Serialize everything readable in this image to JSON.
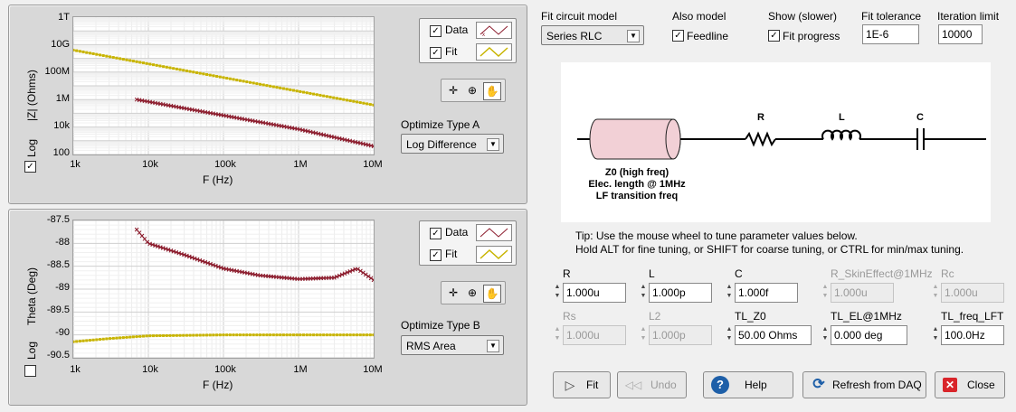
{
  "top_plot": {
    "y_ticks": [
      "1T",
      "10G",
      "100M",
      "1M",
      "10k",
      "100"
    ],
    "x_ticks": [
      "1k",
      "10k",
      "100k",
      "1M",
      "10M"
    ],
    "y_label": "|Z| (Ohms)",
    "x_label": "F (Hz)",
    "log_label": "Log",
    "log_checked": true,
    "legend": [
      {
        "name": "Data",
        "checked": true
      },
      {
        "name": "Fit",
        "checked": true
      }
    ],
    "optimize_label": "Optimize Type A",
    "optimize_value": "Log Difference"
  },
  "bottom_plot": {
    "y_ticks": [
      "-87.5",
      "-88",
      "-88.5",
      "-89",
      "-89.5",
      "-90",
      "-90.5"
    ],
    "x_ticks": [
      "1k",
      "10k",
      "100k",
      "1M",
      "10M"
    ],
    "y_label": "Theta (Deg)",
    "x_label": "F (Hz)",
    "log_label": "Log",
    "log_checked": false,
    "legend": [
      {
        "name": "Data",
        "checked": true
      },
      {
        "name": "Fit",
        "checked": true
      }
    ],
    "optimize_label": "Optimize Type B",
    "optimize_value": "RMS Area"
  },
  "chart_data": [
    {
      "type": "line",
      "xlabel": "F (Hz)",
      "ylabel": "|Z| (Ohms)",
      "xscale": "log",
      "yscale": "log",
      "xlim": [
        1000,
        10000000
      ],
      "ylim": [
        100,
        1000000000000
      ],
      "grid": true,
      "legend_position": "right",
      "series": [
        {
          "name": "Fit",
          "color": "#c8b400",
          "x": [
            1000,
            10000,
            100000,
            1000000,
            10000000
          ],
          "y": [
            4000000000,
            400000000,
            40000000,
            4000000,
            400000
          ]
        },
        {
          "name": "Data",
          "color": "#8b1a2b",
          "x": [
            7000,
            10000,
            100000,
            1000000,
            10000000
          ],
          "y": [
            1000000,
            700000,
            70000,
            7000,
            400
          ]
        }
      ]
    },
    {
      "type": "line",
      "xlabel": "F (Hz)",
      "ylabel": "Theta (Deg)",
      "xscale": "log",
      "xlim": [
        1000,
        10000000
      ],
      "ylim": [
        -90.5,
        -87.5
      ],
      "grid": true,
      "legend_position": "right",
      "series": [
        {
          "name": "Fit",
          "color": "#c8b400",
          "x": [
            1000,
            3000,
            10000,
            100000,
            1000000,
            10000000
          ],
          "y": [
            -90.15,
            -90.08,
            -90.02,
            -90.0,
            -90.0,
            -90.0
          ]
        },
        {
          "name": "Data",
          "color": "#8b1a2b",
          "x": [
            7000,
            10000,
            30000,
            100000,
            300000,
            1000000,
            3000000,
            6000000,
            10000000
          ],
          "y": [
            -87.7,
            -88.0,
            -88.25,
            -88.55,
            -88.7,
            -88.78,
            -88.75,
            -88.55,
            -88.8
          ]
        }
      ]
    }
  ],
  "controls": {
    "fit_model_label": "Fit circuit model",
    "fit_model_value": "Series RLC",
    "also_model_label": "Also model",
    "feedline_label": "Feedline",
    "feedline_checked": true,
    "show_label": "Show (slower)",
    "fit_progress_label": "Fit progress",
    "fit_progress_checked": true,
    "tolerance_label": "Fit tolerance",
    "tolerance_value": "1E-6",
    "iteration_label": "Iteration limit",
    "iteration_value": "10000"
  },
  "circuit": {
    "r": "R",
    "l": "L",
    "c": "C",
    "tl_caption": [
      "Z0 (high freq)",
      "Elec. length @ 1MHz",
      "LF transition freq"
    ]
  },
  "tip": {
    "line1": "Tip: Use the mouse wheel to tune parameter values below.",
    "line2": "Hold ALT for fine tuning, or SHIFT for coarse tuning, or CTRL for min/max tuning."
  },
  "params": [
    {
      "label": "R",
      "value": "1.000u",
      "enabled": true
    },
    {
      "label": "L",
      "value": "1.000p",
      "enabled": true
    },
    {
      "label": "C",
      "value": "1.000f",
      "enabled": true
    },
    {
      "label": "R_SkinEffect@1MHz",
      "value": "1.000u",
      "enabled": false
    },
    {
      "label": "Rc",
      "value": "1.000u",
      "enabled": false
    },
    {
      "label": "Rs",
      "value": "1.000u",
      "enabled": false
    },
    {
      "label": "L2",
      "value": "1.000p",
      "enabled": false
    },
    {
      "label": "TL_Z0",
      "value": "50.00 Ohms",
      "enabled": true
    },
    {
      "label": "TL_EL@1MHz",
      "value": "0.000 deg",
      "enabled": true
    },
    {
      "label": "TL_freq_LFT",
      "value": "100.0Hz",
      "enabled": true
    }
  ],
  "buttons": {
    "fit": "Fit",
    "undo": "Undo",
    "help": "Help",
    "refresh": "Refresh from DAQ",
    "close": "Close"
  },
  "colors": {
    "data": "#8b1a2b",
    "fit": "#c8b400",
    "close_icon": "#d9252a",
    "help_icon": "#1e5fa8"
  }
}
